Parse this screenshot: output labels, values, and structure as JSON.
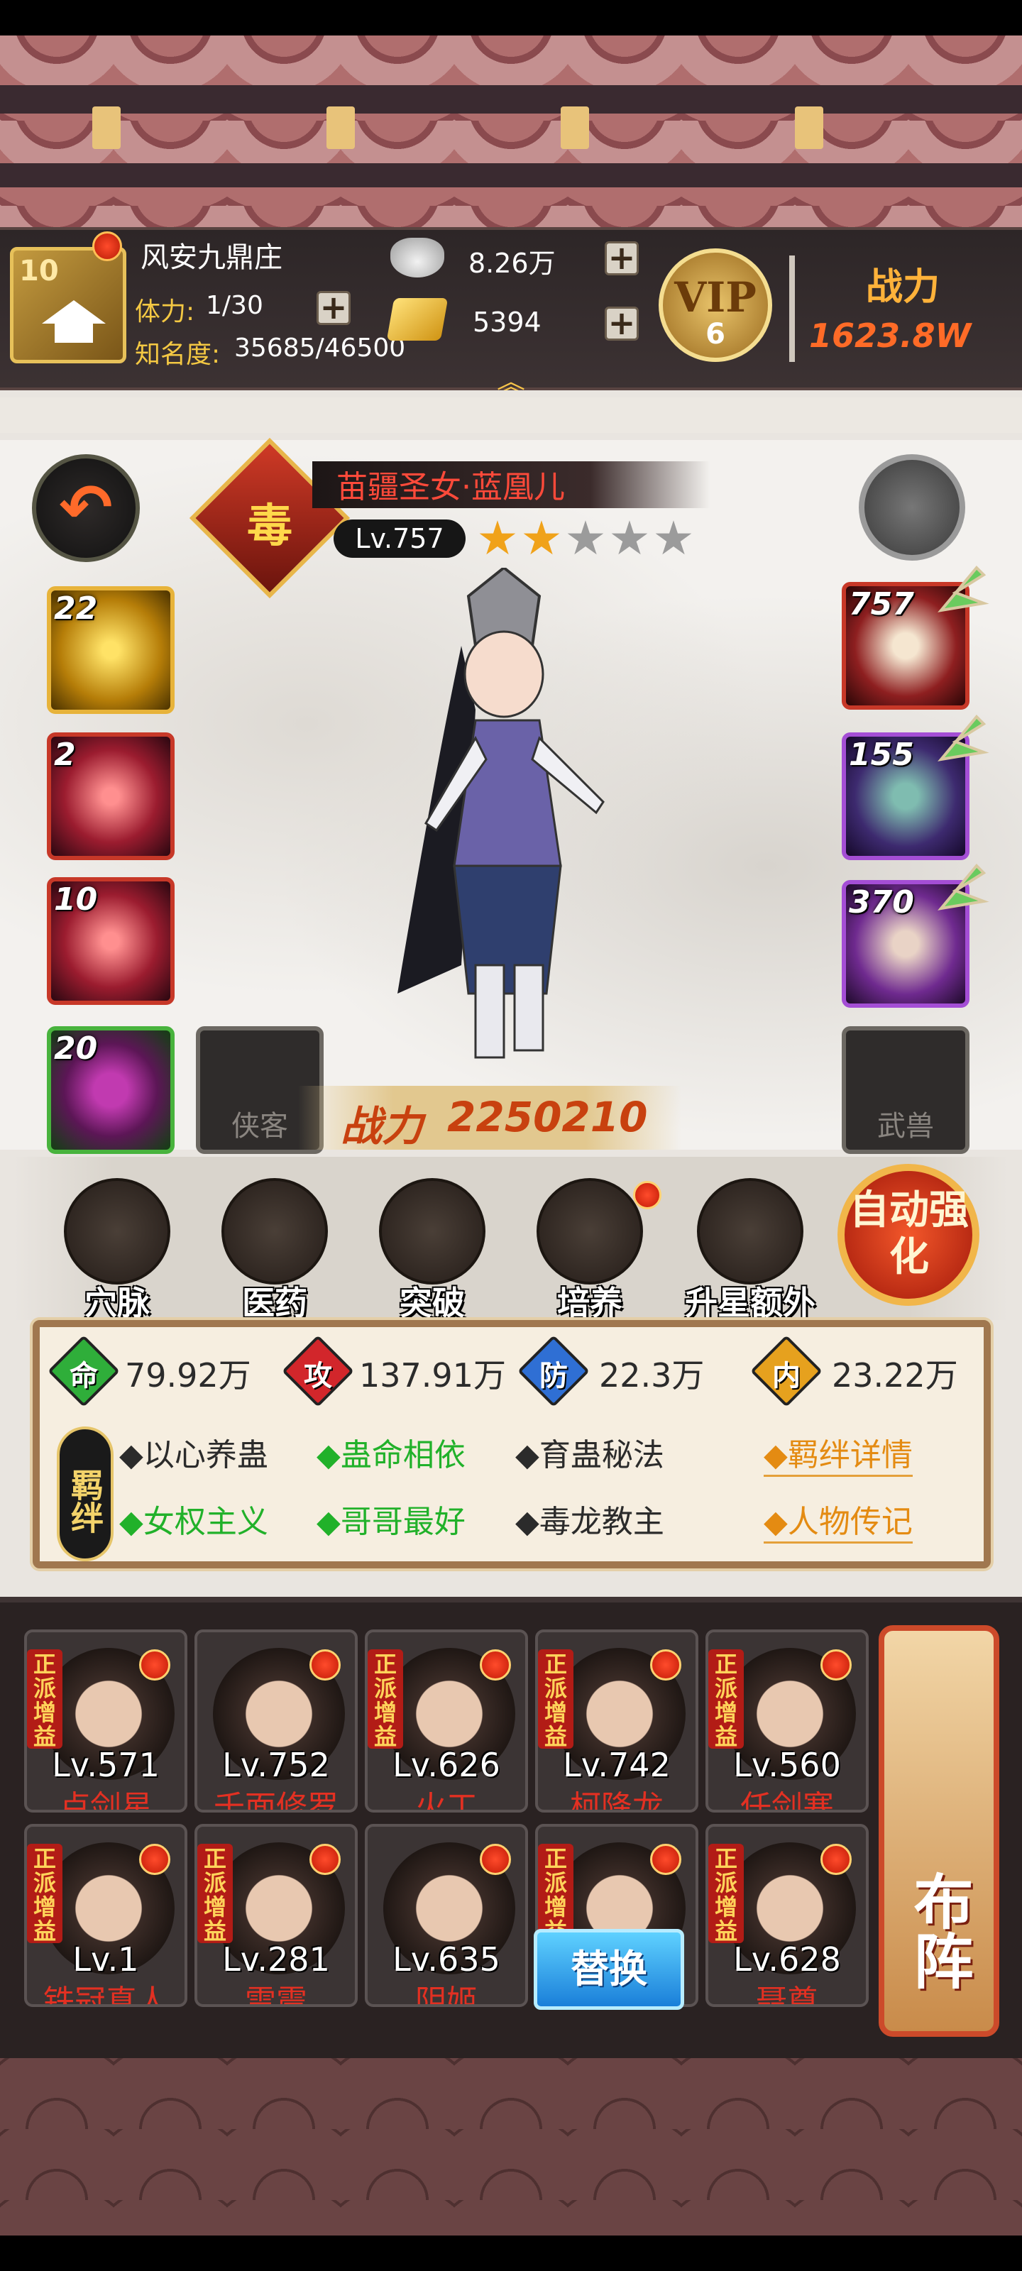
{
  "header": {
    "city_level": "10",
    "city_name": "风安九鼎庄",
    "stamina_label": "体力:",
    "stamina_value": "1/30",
    "fame_label": "知名度:",
    "fame_value": "35685/46500",
    "silver": "8.26万",
    "gold": "5394",
    "expand_icon": "chevron-up-double",
    "vip_label": "VIP",
    "vip_level": "6",
    "power_label": "战力",
    "power_value": "1623.8W"
  },
  "hero": {
    "faction_badge": "毒",
    "name": "苗疆圣女·蓝凰儿",
    "level": "Lv.757",
    "stars": 2,
    "stars_max": 5,
    "battle_label": "战力",
    "battle_value": "2250210"
  },
  "left_cards": [
    {
      "num": "22",
      "icon": "whirlwind-skill-icon"
    },
    {
      "num": "2",
      "icon": "skull-skill-icon"
    },
    {
      "num": "10",
      "icon": "poison-skill-icon"
    },
    {
      "num": "20",
      "icon": "purple-orb-icon"
    }
  ],
  "empty_slots": {
    "companion": "侠客",
    "beast": "武兽"
  },
  "right_cards": [
    {
      "num": "757",
      "icon": "feather-fan-icon"
    },
    {
      "num": "155",
      "icon": "jade-bracelet-icon"
    },
    {
      "num": "370",
      "icon": "teapot-icon"
    }
  ],
  "actions": [
    {
      "label": "穴脉",
      "icon": "meridian-icon",
      "dot": false
    },
    {
      "label": "医药",
      "icon": "herb-icon",
      "dot": false
    },
    {
      "label": "突破",
      "icon": "breakthrough-icon",
      "dot": false
    },
    {
      "label": "培养",
      "icon": "scroll-icon",
      "dot": true
    },
    {
      "label": "升星额外",
      "icon": "star-gift-icon",
      "dot": false
    }
  ],
  "auto_enhance": "自动强化",
  "stats": [
    {
      "icon": "命",
      "value": "79.92万",
      "color": "#2fae3a"
    },
    {
      "icon": "攻",
      "value": "137.91万",
      "color": "#d2262b"
    },
    {
      "icon": "防",
      "value": "22.3万",
      "color": "#2f6fd4"
    },
    {
      "icon": "内",
      "value": "23.22万",
      "color": "#e6a11e"
    }
  ],
  "bond_tag": "羁绊",
  "bonds": [
    {
      "text": "◆以心养蛊",
      "active": false
    },
    {
      "text": "◆蛊命相依",
      "active": true
    },
    {
      "text": "◆育蛊秘法",
      "active": false
    },
    {
      "text": "◆女权主义",
      "active": true
    },
    {
      "text": "◆哥哥最好",
      "active": true
    },
    {
      "text": "◆毒龙教主",
      "active": false
    }
  ],
  "bond_links": [
    "◆羁绊详情",
    "◆人物传记"
  ],
  "faction_tag": "正派增益",
  "team": [
    {
      "level": "Lv.571",
      "name": "卢剑星"
    },
    {
      "level": "Lv.752",
      "name": "千面修罗"
    },
    {
      "level": "Lv.626",
      "name": "火工"
    },
    {
      "level": "Lv.742",
      "name": "柯降龙"
    },
    {
      "level": "Lv.560",
      "name": "任剑寒"
    },
    {
      "level": "Lv.1",
      "name": "铁冠真人"
    },
    {
      "level": "Lv.281",
      "name": "雷震"
    },
    {
      "level": "Lv.635",
      "name": "阴姬"
    },
    {
      "level": "",
      "name": ""
    },
    {
      "level": "Lv.628",
      "name": "聂尊"
    }
  ],
  "replace_label": "替换",
  "formation_label": "布阵"
}
